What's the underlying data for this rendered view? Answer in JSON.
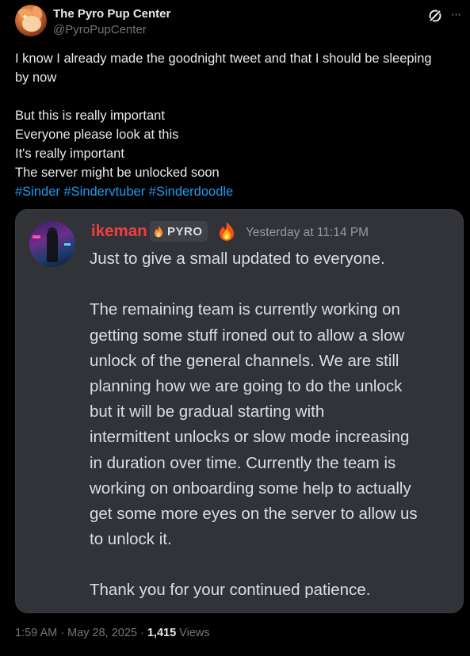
{
  "author": {
    "display_name": "The Pyro Pup Center",
    "handle": "@PyroPupCenter",
    "avatar_icon": "fox-avatar"
  },
  "header_actions": {
    "grok_icon": "grok-icon",
    "more_icon": "more-icon",
    "more_glyph": "···"
  },
  "tweet": {
    "lines": [
      "I know I already made the goodnight tweet and that I should be sleeping",
      "by now",
      "",
      "But this is really important",
      "Everyone please look at this",
      "It's really important",
      "The server might be unlocked soon"
    ],
    "hashtags": [
      "#Sinder",
      "#Sindervtuber",
      "#Sinderdoodle"
    ],
    "hashtag_color": "#1d9bf0"
  },
  "embedded_message": {
    "username": "ikeman",
    "username_color": "#f23f42",
    "tag": "PYRO",
    "timestamp": "Yesterday at 11:14 PM",
    "lines": [
      "Just to give a small updated to everyone.",
      "",
      "The remaining team is currently working on",
      "getting some stuff ironed out to allow a slow",
      "unlock of the general channels. We are still",
      "planning how we are going to do the unlock",
      "but it will be gradual starting with",
      "intermittent unlocks or slow mode increasing",
      "in duration over time. Currently the team is",
      "working on onboarding some help to actually",
      "get some more eyes on the server to allow us",
      "to unlock it.",
      "",
      "Thank you for your continued patience."
    ]
  },
  "meta": {
    "time": "1:59 AM",
    "separator": " · ",
    "date": "May 28, 2025",
    "views_count": "1,415",
    "views_label": " Views"
  }
}
